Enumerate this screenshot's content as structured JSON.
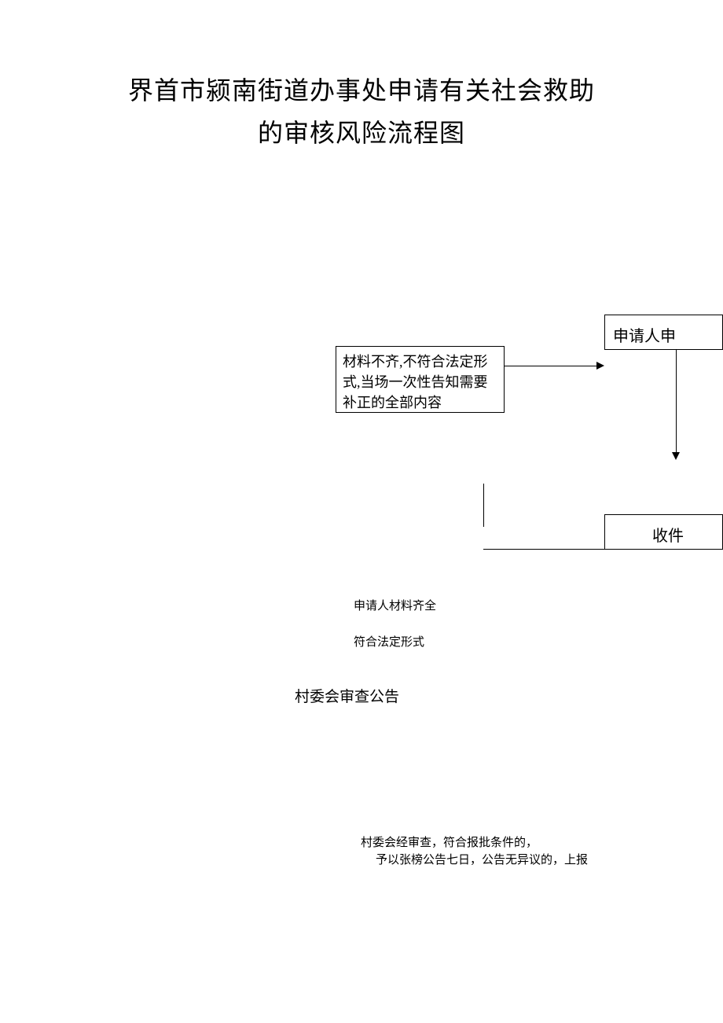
{
  "title": {
    "line1": "界首市颍南街道办事处申请有关社会救助",
    "line2": "的审核风险流程图"
  },
  "boxes": {
    "material_incomplete": "材料不齐,不符合法定形式,当场一次性告知需要补正的全部内容",
    "applicant": "申请人申",
    "receipt": "收件"
  },
  "labels": {
    "material_complete_1": "申请人材料齐全",
    "material_complete_2": "符合法定形式",
    "village_review": "村委会审查公告",
    "village_result_1": "村委会经审查，符合报批条件的，",
    "village_result_2": "予以张榜公告七日，公告无异议的，上报"
  }
}
